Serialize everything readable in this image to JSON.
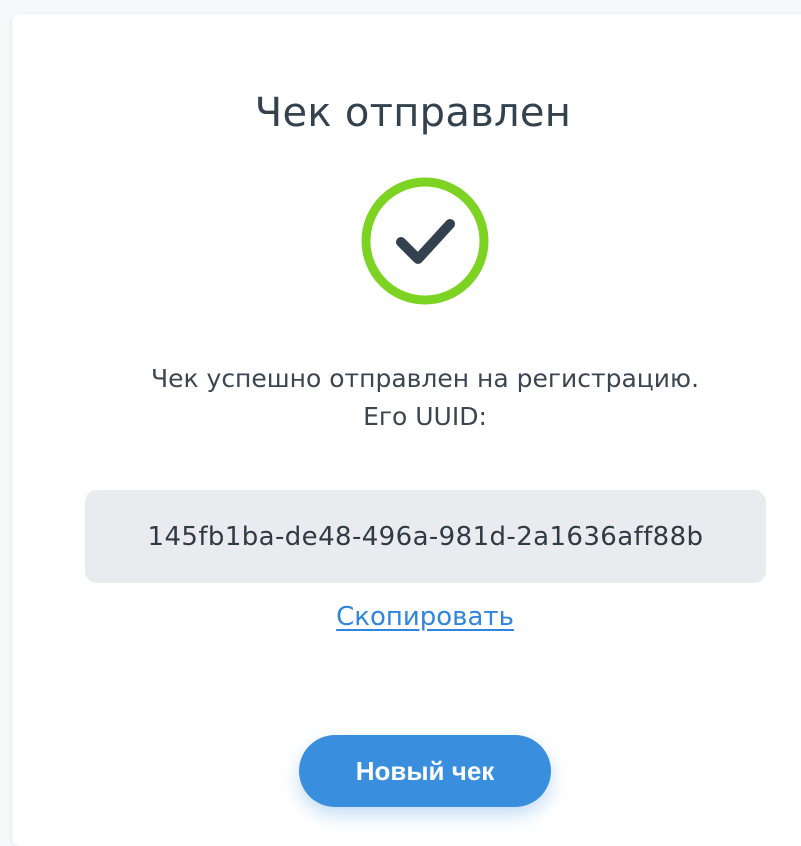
{
  "card": {
    "title": "Чек отправлен",
    "status_icon": "check-circle-icon",
    "message_line1": "Чек успешно отправлен на регистрацию.",
    "message_line2": "Его UUID:",
    "uuid": "145fb1ba-de48-496a-981d-2a1636aff88b",
    "copy_label": "Скопировать",
    "new_check_label": "Новый чек"
  },
  "colors": {
    "success_ring": "#7dd321",
    "check_mark": "#34424f",
    "link": "#2f86dd",
    "button": "#3a8ede"
  }
}
